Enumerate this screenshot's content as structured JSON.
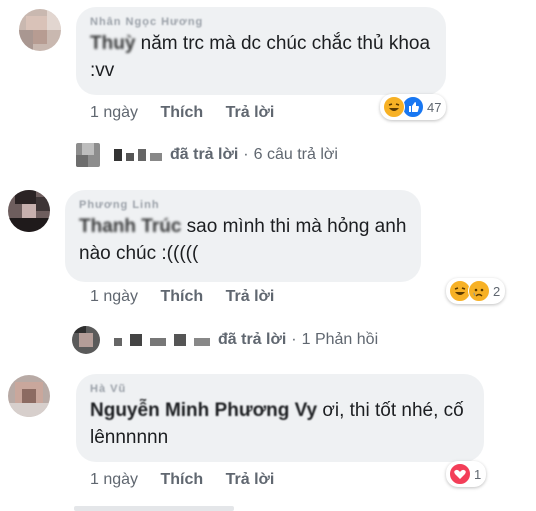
{
  "colors": {
    "text": "#1c1e21",
    "secondary": "#606770",
    "bubble": "#eff1f3",
    "like": "#1877f2",
    "love": "#f33e58",
    "haha": "#f7b125"
  },
  "comments": [
    {
      "author_blurred": "Nhân Ngọc Hương",
      "mention": "Thuỳ",
      "text": " năm trc mà dc chúc chắc thủ khoa :vv",
      "time": "1 ngày",
      "like_label": "Thích",
      "reply_label": "Trả lời",
      "reactions": {
        "icons": [
          "haha-icon",
          "like-icon"
        ],
        "count": "47"
      },
      "reply_summary": {
        "action": "đã trả lời",
        "dot": "·",
        "count": "6 câu trả lời"
      }
    },
    {
      "author_blurred": "Phương Linh",
      "mention": "Thanh Trúc",
      "text": " sao mình thi mà hỏng anh nào chúc :(((((",
      "time": "1 ngày",
      "like_label": "Thích",
      "reply_label": "Trả lời",
      "reactions": {
        "icons": [
          "haha-icon",
          "sad-icon"
        ],
        "count": "2"
      },
      "reply_summary": {
        "action": "đã trả lời",
        "dot": "·",
        "count": "1 Phản hồi"
      }
    },
    {
      "author_blurred": "Hà Vũ",
      "mention": "Nguyễn Minh Phương Vy",
      "text": " ơi, thi tốt nhé, cố lênnnnnn",
      "time": "1 ngày",
      "like_label": "Thích",
      "reply_label": "Trả lời",
      "reactions": {
        "icons": [
          "love-icon"
        ],
        "count": "1"
      }
    }
  ]
}
